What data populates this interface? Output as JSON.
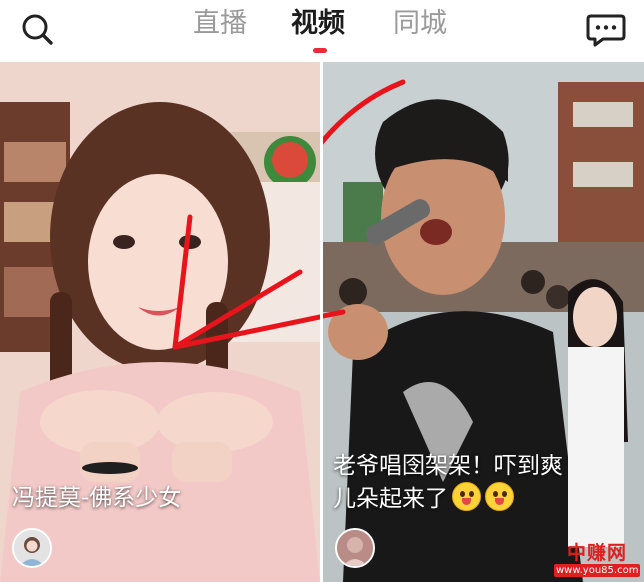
{
  "header": {
    "tabs": [
      {
        "label": "直播",
        "active": false
      },
      {
        "label": "视频",
        "active": true
      },
      {
        "label": "同城",
        "active": false
      }
    ],
    "search_icon": "search-icon",
    "message_icon": "message-bubble-icon",
    "accent_color": "#ee2a3a"
  },
  "feed": {
    "cards": [
      {
        "caption": "冯提莫-佛系少女"
      },
      {
        "caption_line1": "老爷唱囹架架！吓到爽",
        "caption_line2": "儿朵起来了",
        "emoji": "tongue-out-emoji-icon"
      }
    ],
    "annotation_color": "#e8141c"
  },
  "watermark": {
    "brand": "中赚网",
    "url": "www.you85.com"
  }
}
